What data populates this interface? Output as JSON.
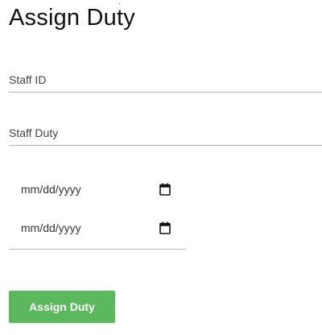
{
  "page": {
    "title": "Assign Duty"
  },
  "form": {
    "staff_id_placeholder": "Staff ID",
    "staff_duty_placeholder": "Staff Duty",
    "start_date_text": "mm/dd/yyyy",
    "end_date_text": "mm/dd/yyyy",
    "calendar_icon": "calendar-icon",
    "submit_label": "Assign Duty"
  },
  "colors": {
    "button_bg": "#5cb85c",
    "underline": "#b5b5b5"
  }
}
